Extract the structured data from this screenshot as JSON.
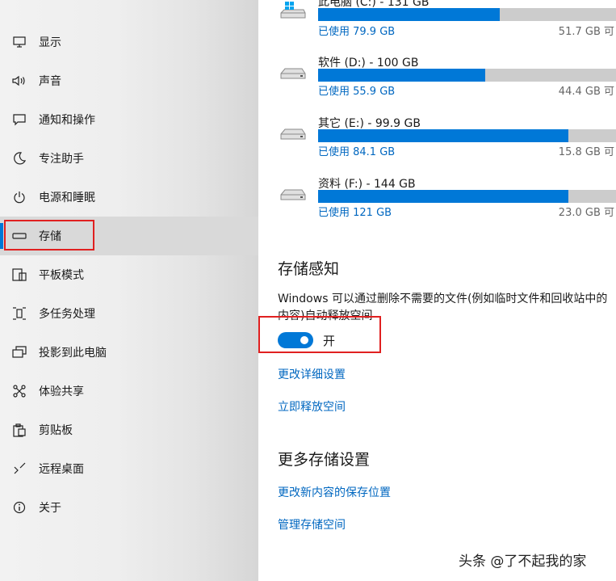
{
  "sidebar": {
    "items": [
      {
        "label": "显示",
        "icon": "monitor-icon"
      },
      {
        "label": "声音",
        "icon": "speaker-icon"
      },
      {
        "label": "通知和操作",
        "icon": "notification-icon"
      },
      {
        "label": "专注助手",
        "icon": "moon-icon"
      },
      {
        "label": "电源和睡眠",
        "icon": "power-icon"
      },
      {
        "label": "存储",
        "icon": "storage-icon",
        "selected": true
      },
      {
        "label": "平板模式",
        "icon": "tablet-icon"
      },
      {
        "label": "多任务处理",
        "icon": "multitask-icon"
      },
      {
        "label": "投影到此电脑",
        "icon": "project-icon"
      },
      {
        "label": "体验共享",
        "icon": "share-icon"
      },
      {
        "label": "剪贴板",
        "icon": "clipboard-icon"
      },
      {
        "label": "远程桌面",
        "icon": "remote-desktop-icon"
      },
      {
        "label": "关于",
        "icon": "info-icon"
      }
    ]
  },
  "drives": [
    {
      "title": "此电脑 (C:) - 131 GB",
      "used_label": "已使用 79.9 GB",
      "free_label": "51.7 GB 可",
      "used_fraction": 0.61,
      "icon": "windows-drive-icon"
    },
    {
      "title": "软件 (D:) - 100 GB",
      "used_label": "已使用 55.9 GB",
      "free_label": "44.4 GB 可",
      "used_fraction": 0.56,
      "icon": "drive-icon"
    },
    {
      "title": "其它 (E:) - 99.9 GB",
      "used_label": "已使用 84.1 GB",
      "free_label": "15.8 GB 可",
      "used_fraction": 0.84,
      "icon": "drive-icon"
    },
    {
      "title": "资料 (F:) - 144 GB",
      "used_label": "已使用 121 GB",
      "free_label": "23.0 GB 可",
      "used_fraction": 0.84,
      "icon": "drive-icon"
    }
  ],
  "storage_sense": {
    "title": "存储感知",
    "description_line1": "Windows 可以通过删除不需要的文件(例如临时文件和回收站中的",
    "description_line2": "内容)自动释放空间",
    "toggle_label": "开",
    "toggle_on": true,
    "links": [
      "更改详细设置",
      "立即释放空间"
    ]
  },
  "more_settings": {
    "title": "更多存储设置",
    "links": [
      "更改新内容的保存位置",
      "管理存储空间"
    ]
  },
  "watermark": "头条 @了不起我的家",
  "colors": {
    "accent": "#0078d7",
    "link": "#0067c0",
    "highlight": "#e02020",
    "bar_track": "#cccccc"
  }
}
